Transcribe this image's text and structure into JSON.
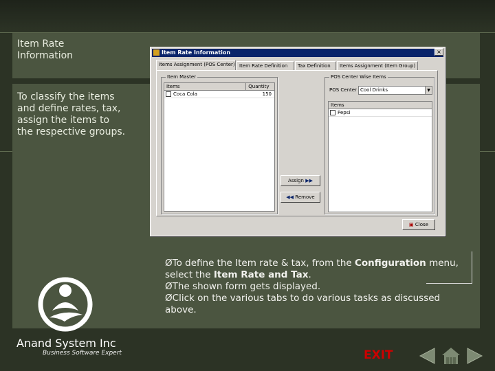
{
  "slide": {
    "title": "Item Rate Information",
    "description": "To classify the items and define rates, tax, assign the items to the respective groups.",
    "instructions": [
      {
        "prefix": "Ø",
        "parts": [
          {
            "t": "To define the Item rate & tax, from the ",
            "b": false
          },
          {
            "t": "Configuration",
            "b": true
          },
          {
            "t": " menu, select the ",
            "b": false
          },
          {
            "t": "Item Rate and Tax",
            "b": true
          },
          {
            "t": ".",
            "b": false
          }
        ]
      },
      {
        "prefix": "Ø",
        "parts": [
          {
            "t": "The shown form gets displayed.",
            "b": false
          }
        ]
      },
      {
        "prefix": "Ø",
        "parts": [
          {
            "t": "Click on the various tabs to do various tasks as discussed above.",
            "b": false
          }
        ]
      }
    ],
    "company": "Anand System Inc",
    "tagline": "Business Software Expert",
    "exit_label": "EXIT"
  },
  "dialog": {
    "title": "Item Rate Information",
    "close_glyph": "×",
    "tabs": [
      "Items Assignment (POS Center)",
      "Item Rate Definition",
      "Tax Definition",
      "Items Assignment (Item Group)"
    ],
    "item_master": {
      "label": "Item Master",
      "columns": [
        "Items",
        "Quantity"
      ],
      "rows": [
        {
          "item": "Coca Cola",
          "quantity": "150"
        }
      ]
    },
    "pos_center": {
      "label": "POS Center Wise Items",
      "combo_label": "POS Center",
      "combo_value": "Cool Drinks",
      "columns": [
        "Items"
      ],
      "rows": [
        {
          "item": "Pepsi"
        }
      ]
    },
    "assign_label": "Assign",
    "remove_label": "Remove",
    "close_label": "Close"
  },
  "colors": {
    "exit": "#cc0000",
    "title_bar": "#0a246a",
    "panel": "#4b5540"
  }
}
